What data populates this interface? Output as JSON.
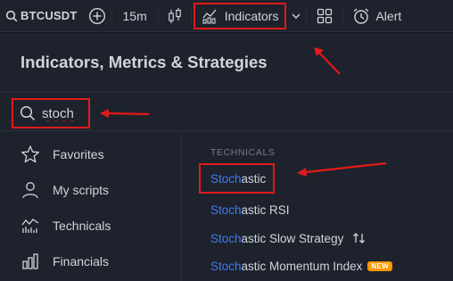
{
  "toolbar": {
    "symbol": "BTCUSDT",
    "interval": "15m",
    "indicators_label": "Indicators",
    "alert_label": "Alert"
  },
  "dialog": {
    "title": "Indicators, Metrics & Strategies",
    "search": {
      "value": "stoch",
      "placeholder": "Search"
    },
    "sidebar": {
      "items": [
        {
          "label": "Favorites",
          "icon": "star-icon"
        },
        {
          "label": "My scripts",
          "icon": "user-icon"
        },
        {
          "label": "Technicals",
          "icon": "technicals-icon"
        },
        {
          "label": "Financials",
          "icon": "financials-icon"
        }
      ]
    },
    "results": {
      "section_label": "TECHNICALS",
      "query_highlight": "Stoch",
      "items": [
        {
          "match": "Stoch",
          "rest": "astic"
        },
        {
          "match": "Stoch",
          "rest": "astic RSI"
        },
        {
          "match": "Stoch",
          "rest": "astic Slow Strategy",
          "icon": "strategy-icon"
        },
        {
          "match": "Stoch",
          "rest": "astic Momentum Index",
          "badge": "NEW"
        }
      ]
    }
  },
  "colors": {
    "background": "#131722",
    "panel": "#1e222d",
    "text": "#d1d4dc",
    "muted": "#787b86",
    "highlight": "#3d7cf5",
    "annotation": "#e21a1a",
    "badge": "#ff9800"
  }
}
